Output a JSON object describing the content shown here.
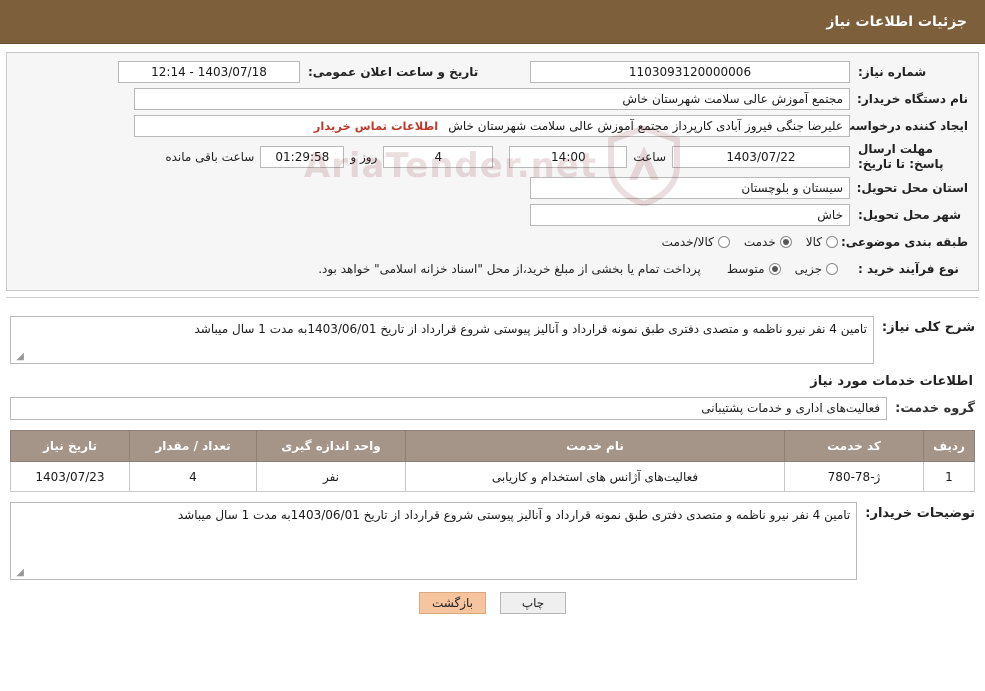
{
  "header": {
    "title": "جزئیات اطلاعات نیاز"
  },
  "info": {
    "need_number_label": "شماره نیاز:",
    "need_number_value": "1103093120000006",
    "announce_date_label": "تاریخ و ساعت اعلان عمومی:",
    "announce_date_value": "1403/07/18 - 12:14",
    "buyer_org_label": "نام دستگاه خریدار:",
    "buyer_org_value": "مجتمع آموزش عالی سلامت شهرستان خاش",
    "requester_label": "ایجاد کننده درخواست:",
    "requester_value": "علیرضا جنگی فیروز آبادی کارپرداز مجتمع آموزش عالی سلامت شهرستان خاش",
    "contact_link": "اطلاعات تماس خریدار",
    "deadline_label": "مهلت ارسال پاسخ: تا تاریخ:",
    "deadline_date": "1403/07/22",
    "hour_label": "ساعت",
    "deadline_time": "14:00",
    "days_value": "4",
    "days_label": "روز و",
    "remaining_time": "01:29:58",
    "remaining_label": "ساعت باقی مانده",
    "province_label": "استان محل تحویل:",
    "province_value": "سیستان و بلوچستان",
    "city_label": "شهر محل تحویل:",
    "city_value": "خاش",
    "category_label": "طبقه بندی موضوعی:",
    "category_options": [
      {
        "label": "کالا",
        "selected": false
      },
      {
        "label": "خدمت",
        "selected": true
      },
      {
        "label": "کالا/خدمت",
        "selected": false
      }
    ],
    "purchase_type_label": "نوع فرآیند خرید :",
    "purchase_type_options": [
      {
        "label": "جزیی",
        "selected": false
      },
      {
        "label": "متوسط",
        "selected": true
      }
    ],
    "purchase_note": "پرداخت تمام یا بخشی از مبلغ خرید،از محل \"اسناد خزانه اسلامی\" خواهد بود.",
    "watermark_text": "AriaTender.net"
  },
  "summary": {
    "label": "شرح کلی نیاز:",
    "text": "تامین 4 نفر نیرو ناظمه و متصدی دفتری طبق نمونه قرارداد و آنالیز پیوستی شروع قرارداد از تاریخ 1403/06/01به مدت 1 سال میباشد"
  },
  "services": {
    "section_title": "اطلاعات خدمات مورد نیاز",
    "group_label": "گروه خدمت:",
    "group_value": "فعالیت‌های اداری و خدمات پشتیبانی",
    "columns": [
      "ردیف",
      "کد خدمت",
      "نام خدمت",
      "واحد اندازه گیری",
      "تعداد / مقدار",
      "تاریخ نیاز"
    ],
    "rows": [
      {
        "row": "1",
        "code": "ژ-78-780",
        "name": "فعالیت‌های آژانس های استخدام و کاریابی",
        "unit": "نفر",
        "qty": "4",
        "date": "1403/07/23"
      }
    ]
  },
  "buyer_notes": {
    "label": "توضیحات خریدار:",
    "text": "تامین 4 نفر نیرو ناظمه و متصدی دفتری طبق نمونه قرارداد و آنالیز پیوستی شروع قرارداد از تاریخ 1403/06/01به مدت 1 سال میباشد"
  },
  "footer": {
    "print_button": "چاپ",
    "back_button": "بازگشت"
  },
  "colors": {
    "header_bg": "#7d5f3c",
    "table_header_bg": "#a59488",
    "link": "#c0392b",
    "back_button": "#f6c49e"
  }
}
